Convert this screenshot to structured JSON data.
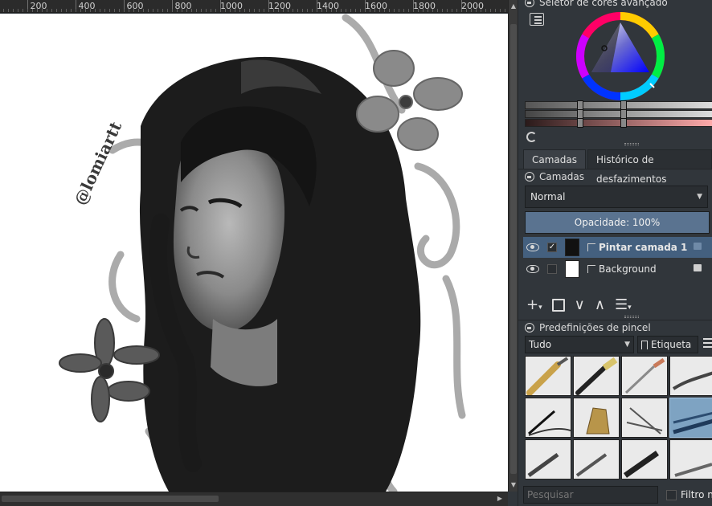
{
  "ruler": {
    "labels": [
      "200",
      "400",
      "600",
      "800",
      "1000",
      "1200",
      "1400",
      "1600",
      "1800",
      "2000"
    ]
  },
  "color_selector": {
    "title": "Seletor de cores avançado"
  },
  "tabs": [
    {
      "label": "Camadas"
    },
    {
      "label": "Histórico de desfazimentos"
    }
  ],
  "layers": {
    "title": "Camadas",
    "blend_mode": "Normal",
    "opacity": "Opacidade:  100%",
    "items": [
      {
        "name": "Pintar camada 1",
        "selected": true,
        "checked": true
      },
      {
        "name": "Background",
        "selected": false,
        "checked": false
      }
    ]
  },
  "canvas": {
    "signature": "@lomiartt"
  },
  "brush_presets": {
    "title": "Predefinições de pincel",
    "filter": "Tudo",
    "tag_label": "Etiqueta",
    "search_placeholder": "Pesquisar",
    "filter_checkbox_label": "Filtro na"
  }
}
